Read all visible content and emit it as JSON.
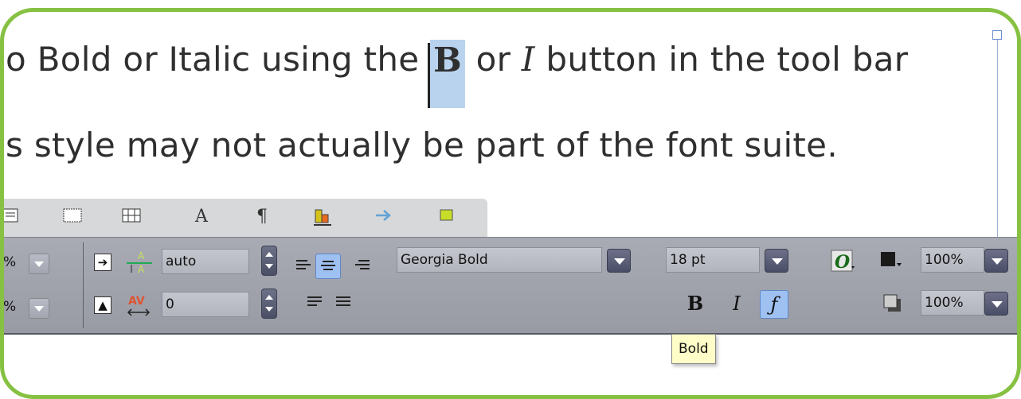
{
  "document": {
    "line1_pre": "o Bold or Italic using the ",
    "line1_bold": "B",
    "line1_mid": " or ",
    "line1_italic": "I",
    "line1_post": " button in the tool bar",
    "line2": "s style may not actually be part of the font suite."
  },
  "toolbar": {
    "tabs": [
      "text-frame-icon",
      "frame-icon",
      "table-icon",
      "character-icon",
      "paragraph-icon",
      "color-icon",
      "arrow-icon",
      "shape-icon"
    ],
    "left_pct_top": "%",
    "left_pct_bottom": "%",
    "leading_value": "auto",
    "tracking_value": "0",
    "font_name": "Georgia Bold",
    "font_size": "18 pt",
    "opacity_top": "100%",
    "opacity_bottom": "100%",
    "bold_glyph": "B",
    "italic_glyph": "I",
    "func_glyph": "ƒ"
  },
  "tooltip": {
    "text": "Bold"
  },
  "colors": {
    "frame_border": "#86c142",
    "selection": "#b9d3ee",
    "toolbar": "#a9abb4",
    "tooltip_bg": "#fffec8"
  }
}
